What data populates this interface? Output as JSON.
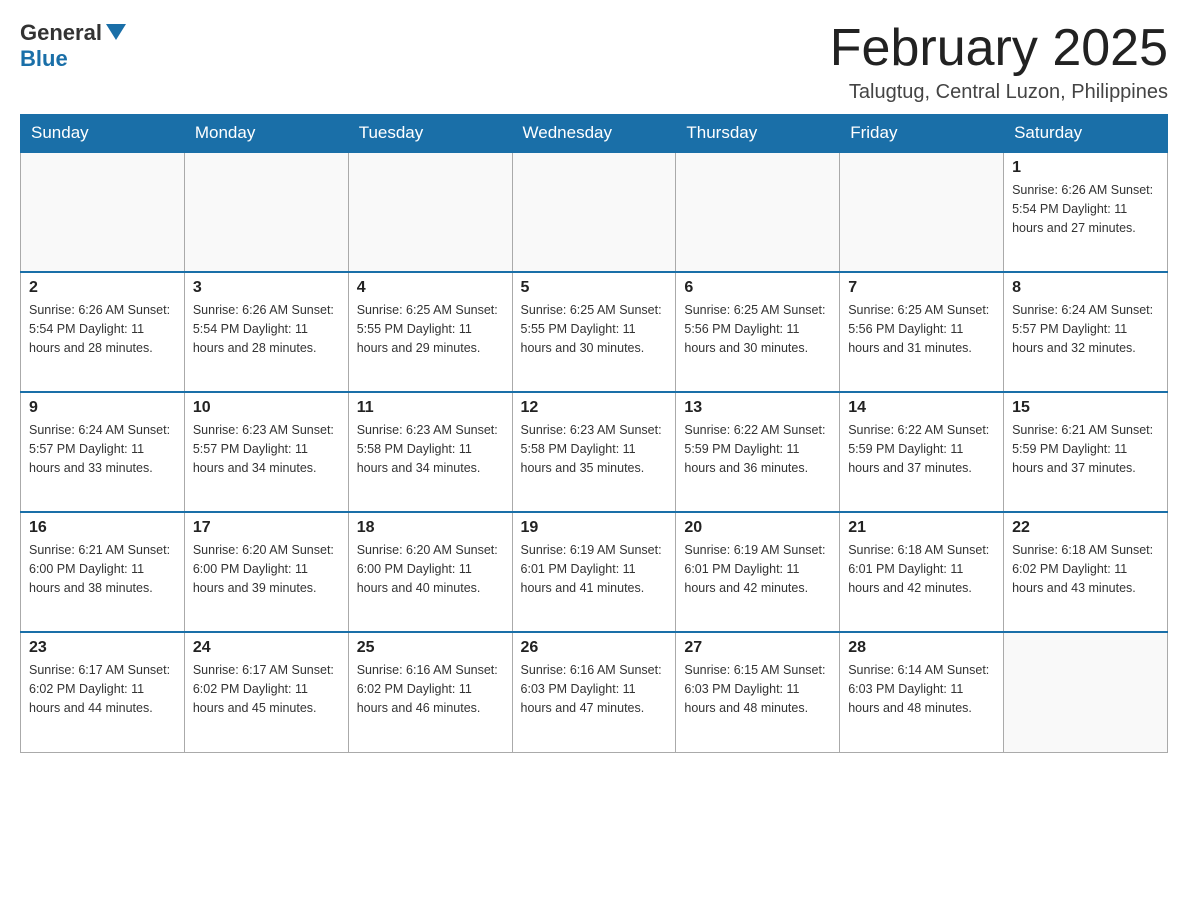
{
  "header": {
    "logo_general": "General",
    "logo_blue": "Blue",
    "month_title": "February 2025",
    "location": "Talugtug, Central Luzon, Philippines"
  },
  "days_of_week": [
    "Sunday",
    "Monday",
    "Tuesday",
    "Wednesday",
    "Thursday",
    "Friday",
    "Saturday"
  ],
  "weeks": [
    [
      {
        "day": "",
        "info": ""
      },
      {
        "day": "",
        "info": ""
      },
      {
        "day": "",
        "info": ""
      },
      {
        "day": "",
        "info": ""
      },
      {
        "day": "",
        "info": ""
      },
      {
        "day": "",
        "info": ""
      },
      {
        "day": "1",
        "info": "Sunrise: 6:26 AM\nSunset: 5:54 PM\nDaylight: 11 hours and 27 minutes."
      }
    ],
    [
      {
        "day": "2",
        "info": "Sunrise: 6:26 AM\nSunset: 5:54 PM\nDaylight: 11 hours and 28 minutes."
      },
      {
        "day": "3",
        "info": "Sunrise: 6:26 AM\nSunset: 5:54 PM\nDaylight: 11 hours and 28 minutes."
      },
      {
        "day": "4",
        "info": "Sunrise: 6:25 AM\nSunset: 5:55 PM\nDaylight: 11 hours and 29 minutes."
      },
      {
        "day": "5",
        "info": "Sunrise: 6:25 AM\nSunset: 5:55 PM\nDaylight: 11 hours and 30 minutes."
      },
      {
        "day": "6",
        "info": "Sunrise: 6:25 AM\nSunset: 5:56 PM\nDaylight: 11 hours and 30 minutes."
      },
      {
        "day": "7",
        "info": "Sunrise: 6:25 AM\nSunset: 5:56 PM\nDaylight: 11 hours and 31 minutes."
      },
      {
        "day": "8",
        "info": "Sunrise: 6:24 AM\nSunset: 5:57 PM\nDaylight: 11 hours and 32 minutes."
      }
    ],
    [
      {
        "day": "9",
        "info": "Sunrise: 6:24 AM\nSunset: 5:57 PM\nDaylight: 11 hours and 33 minutes."
      },
      {
        "day": "10",
        "info": "Sunrise: 6:23 AM\nSunset: 5:57 PM\nDaylight: 11 hours and 34 minutes."
      },
      {
        "day": "11",
        "info": "Sunrise: 6:23 AM\nSunset: 5:58 PM\nDaylight: 11 hours and 34 minutes."
      },
      {
        "day": "12",
        "info": "Sunrise: 6:23 AM\nSunset: 5:58 PM\nDaylight: 11 hours and 35 minutes."
      },
      {
        "day": "13",
        "info": "Sunrise: 6:22 AM\nSunset: 5:59 PM\nDaylight: 11 hours and 36 minutes."
      },
      {
        "day": "14",
        "info": "Sunrise: 6:22 AM\nSunset: 5:59 PM\nDaylight: 11 hours and 37 minutes."
      },
      {
        "day": "15",
        "info": "Sunrise: 6:21 AM\nSunset: 5:59 PM\nDaylight: 11 hours and 37 minutes."
      }
    ],
    [
      {
        "day": "16",
        "info": "Sunrise: 6:21 AM\nSunset: 6:00 PM\nDaylight: 11 hours and 38 minutes."
      },
      {
        "day": "17",
        "info": "Sunrise: 6:20 AM\nSunset: 6:00 PM\nDaylight: 11 hours and 39 minutes."
      },
      {
        "day": "18",
        "info": "Sunrise: 6:20 AM\nSunset: 6:00 PM\nDaylight: 11 hours and 40 minutes."
      },
      {
        "day": "19",
        "info": "Sunrise: 6:19 AM\nSunset: 6:01 PM\nDaylight: 11 hours and 41 minutes."
      },
      {
        "day": "20",
        "info": "Sunrise: 6:19 AM\nSunset: 6:01 PM\nDaylight: 11 hours and 42 minutes."
      },
      {
        "day": "21",
        "info": "Sunrise: 6:18 AM\nSunset: 6:01 PM\nDaylight: 11 hours and 42 minutes."
      },
      {
        "day": "22",
        "info": "Sunrise: 6:18 AM\nSunset: 6:02 PM\nDaylight: 11 hours and 43 minutes."
      }
    ],
    [
      {
        "day": "23",
        "info": "Sunrise: 6:17 AM\nSunset: 6:02 PM\nDaylight: 11 hours and 44 minutes."
      },
      {
        "day": "24",
        "info": "Sunrise: 6:17 AM\nSunset: 6:02 PM\nDaylight: 11 hours and 45 minutes."
      },
      {
        "day": "25",
        "info": "Sunrise: 6:16 AM\nSunset: 6:02 PM\nDaylight: 11 hours and 46 minutes."
      },
      {
        "day": "26",
        "info": "Sunrise: 6:16 AM\nSunset: 6:03 PM\nDaylight: 11 hours and 47 minutes."
      },
      {
        "day": "27",
        "info": "Sunrise: 6:15 AM\nSunset: 6:03 PM\nDaylight: 11 hours and 48 minutes."
      },
      {
        "day": "28",
        "info": "Sunrise: 6:14 AM\nSunset: 6:03 PM\nDaylight: 11 hours and 48 minutes."
      },
      {
        "day": "",
        "info": ""
      }
    ]
  ]
}
